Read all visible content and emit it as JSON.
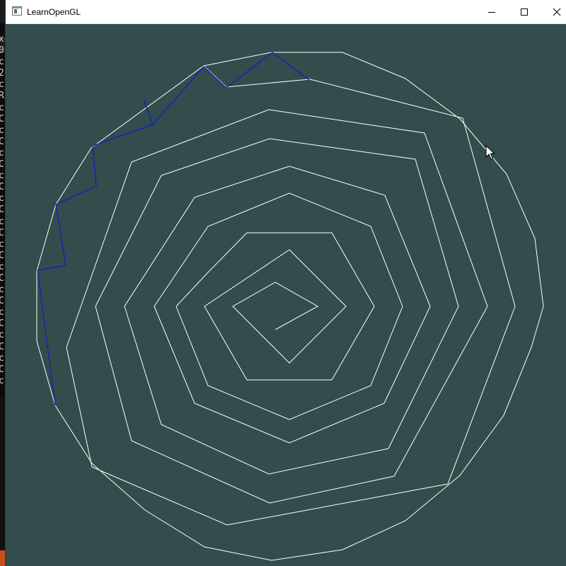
{
  "window": {
    "title": "LearnOpenGL"
  },
  "titlebar_controls": {
    "minimize_icon": "minimize-icon",
    "maximize_icon": "maximize-icon",
    "close_icon": "close-icon"
  },
  "background_console": {
    "visible_fragments": [
      "xe",
      "0",
      "c",
      "2",
      "c",
      "R",
      "c",
      "C",
      "c",
      "C",
      "c",
      "C",
      "c",
      "C",
      "c",
      "C",
      "c",
      "C",
      "c",
      "C",
      "c",
      "C",
      "c",
      "C",
      "c",
      "C",
      "c",
      "C",
      "c",
      "C",
      "cu"
    ]
  },
  "scene": {
    "clear_color": "#334c4c",
    "spiral_color": "#ffffff",
    "highlight_color": "#0b1ec8"
  },
  "cursor": {
    "icon": "arrow-cursor-icon"
  }
}
